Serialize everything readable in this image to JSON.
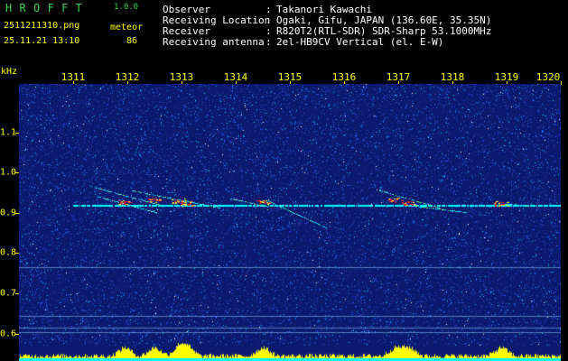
{
  "app": {
    "title": "HROFFT",
    "version": "1.0.0"
  },
  "file": {
    "name": "2511211310.png",
    "datetime": "25.11.21 13:10"
  },
  "detection": {
    "label": "meteor",
    "count": "86"
  },
  "station": [
    {
      "label": "Observer",
      "value": "Takanori Kawachi"
    },
    {
      "label": "Receiving Location",
      "value": "Ogaki, Gifu, JAPAN (136.60E, 35.35N)"
    },
    {
      "label": "Receiver",
      "value": "R820T2(RTL-SDR) SDR-Sharp 53.1000MHz"
    },
    {
      "label": "Receiving antenna",
      "value": "2el-HB9CV Vertical (el. E-W)"
    }
  ],
  "colon": ":",
  "axis": {
    "y_unit": "kHz",
    "y_ticks": [
      "1.1",
      "1.0",
      "0.9",
      "0.8",
      "0.7",
      "0.6"
    ],
    "y_tick_values": [
      1.1,
      1.0,
      0.9,
      0.8,
      0.7,
      0.6
    ],
    "y_range": [
      0.57,
      1.22
    ],
    "x_ticks": [
      "1311",
      "1312",
      "1313",
      "1314",
      "1315",
      "1316",
      "1317",
      "1318",
      "1319",
      "1320"
    ],
    "x_range_minutes": [
      1310,
      1320
    ]
  },
  "colors": {
    "title": "#39d353",
    "info": "#ffff00",
    "station": "#ffffff",
    "background": "#0b1a6e",
    "carrier": "#00ffff",
    "meteor_head": "#ff2020",
    "level_bar": "#ffff00"
  },
  "signals": {
    "carrier_khz": 0.92,
    "meteors": [
      {
        "start_min": 1311.35,
        "end_min": 1312.7,
        "khz_start": 0.965,
        "khz_end": 0.915
      },
      {
        "start_min": 1311.45,
        "end_min": 1312.55,
        "khz_start": 0.94,
        "khz_end": 0.9
      },
      {
        "start_min": 1312.1,
        "end_min": 1313.7,
        "khz_start": 0.955,
        "khz_end": 0.912
      },
      {
        "start_min": 1313.9,
        "end_min": 1314.6,
        "khz_start": 0.935,
        "khz_end": 0.915
      },
      {
        "start_min": 1314.6,
        "end_min": 1315.7,
        "khz_start": 0.93,
        "khz_end": 0.86
      },
      {
        "start_min": 1316.65,
        "end_min": 1317.75,
        "khz_start": 0.955,
        "khz_end": 0.912
      },
      {
        "start_min": 1317.1,
        "end_min": 1318.3,
        "khz_start": 0.92,
        "khz_end": 0.9
      },
      {
        "start_min": 1318.85,
        "end_min": 1319.4,
        "khz_start": 0.922,
        "khz_end": 0.918
      }
    ],
    "heads": [
      {
        "min": 1311.95,
        "khz": 0.925
      },
      {
        "min": 1312.5,
        "khz": 0.93
      },
      {
        "min": 1312.95,
        "khz": 0.928
      },
      {
        "min": 1313.1,
        "khz": 0.922
      },
      {
        "min": 1314.5,
        "khz": 0.925
      },
      {
        "min": 1316.95,
        "khz": 0.93
      },
      {
        "min": 1317.2,
        "khz": 0.922
      },
      {
        "min": 1318.9,
        "khz": 0.922
      }
    ],
    "hlines_khz": [
      0.765,
      0.645,
      0.615,
      0.604
    ]
  }
}
